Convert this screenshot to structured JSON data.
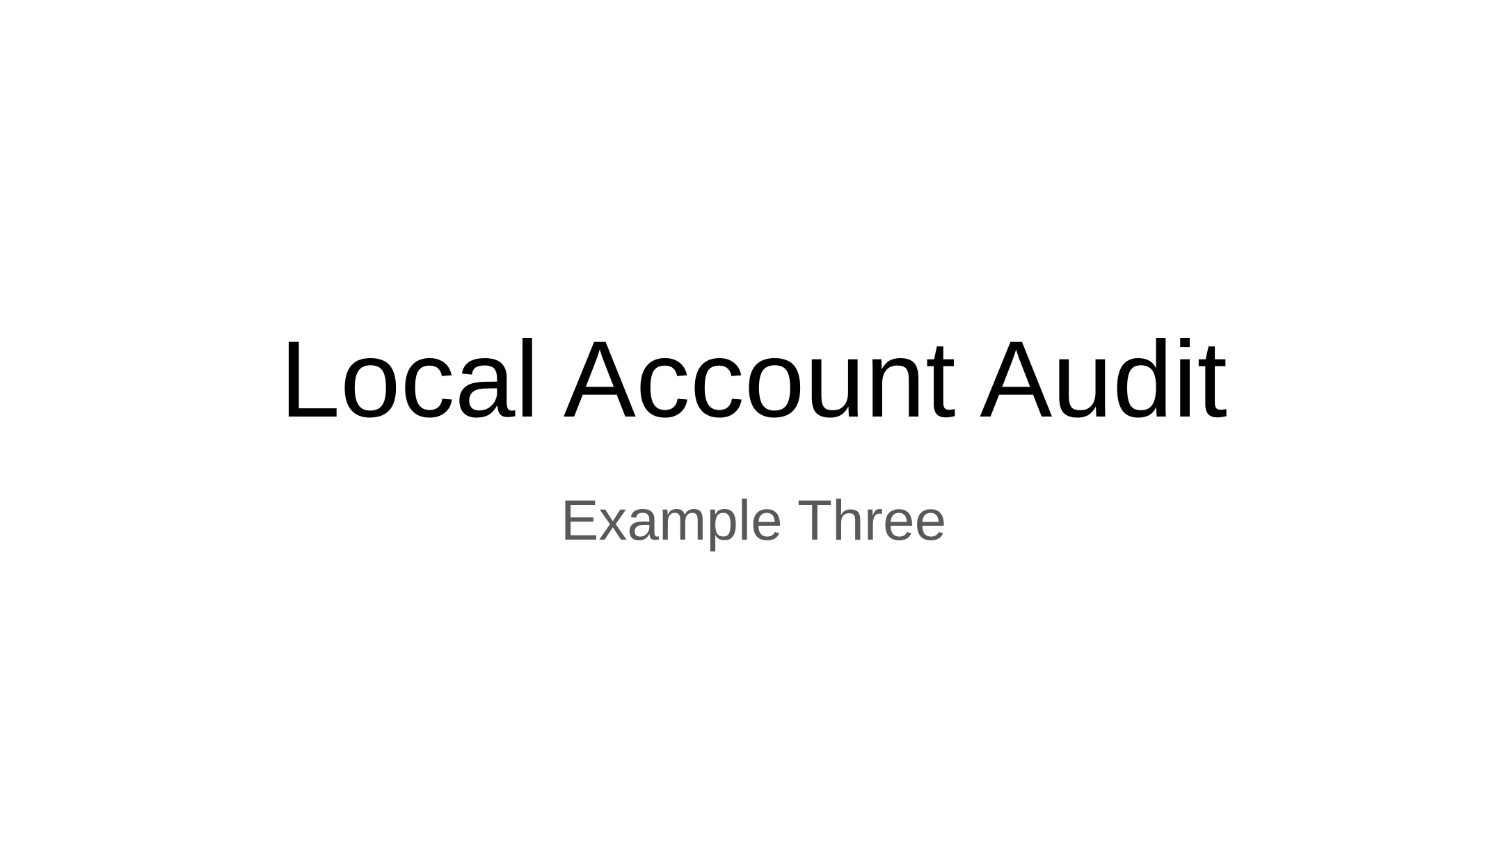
{
  "slide": {
    "title": "Local Account Audit",
    "subtitle": "Example Three"
  },
  "colors": {
    "background": "#ffffff",
    "title": "#000000",
    "subtitle": "#595959"
  }
}
